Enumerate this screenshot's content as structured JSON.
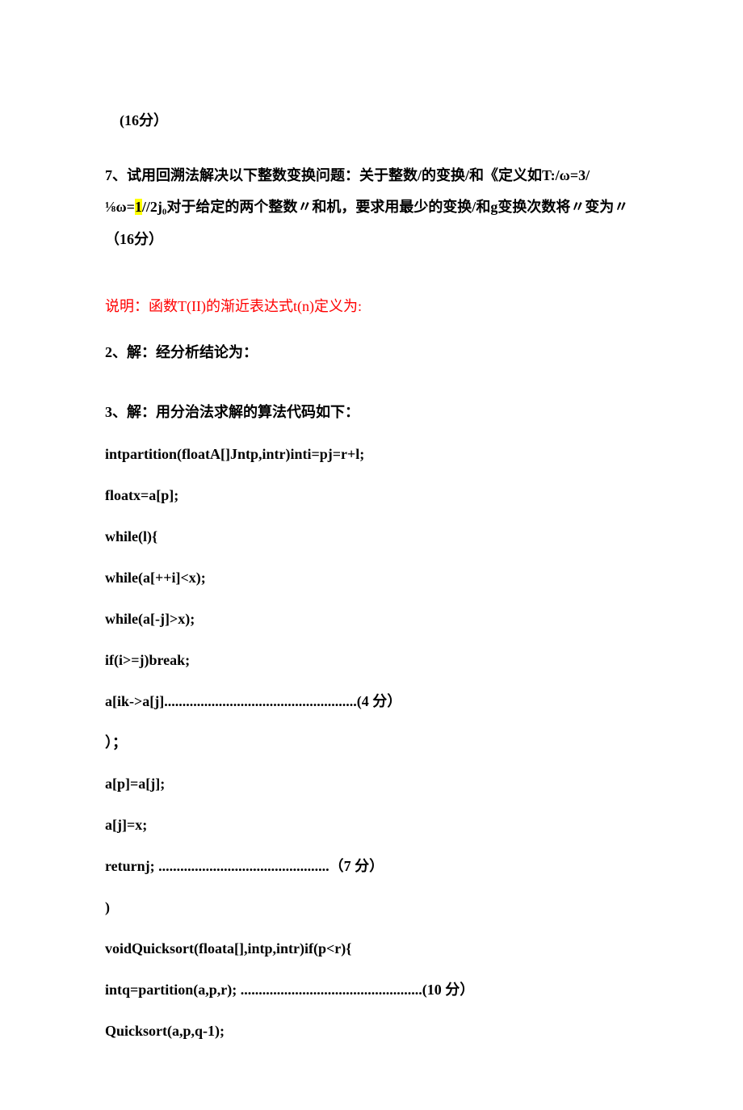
{
  "top": {
    "score16": "(16分）",
    "q7": "7、试用回溯法解决以下整数变换问题：关于整数/的变换/和《定义如T:/ω=3/⅛ω=",
    "q7_hl": "1",
    "q7_tail": "//2j₀对于给定的两个整数〃和机，要求用最少的变换/和g变换次数将〃变为〃（16分）"
  },
  "note": "说明：函数T(II)的渐近表达式t(n)定义为:",
  "a2": "2、解：经分析结论为：",
  "a3": "3、解：用分治法求解的算法代码如下：",
  "code": {
    "l1": "intpartition(floatA[]Jntp,intr)inti=pj=r+l;",
    "l2": "floatx=a[p];",
    "l3": "while(l){",
    "l4": "while(a[++i]<x);",
    "l5": "while(a[-j]>x);",
    "l6": "if(i>=j)break;",
    "l7": "a[ik->a[j].....................................................(4   分）",
    "l8": "）；",
    "l9": "a[p]=a[j];",
    "l10": "a[j]=x;",
    "l11": "returnj; ...............................................（7   分）",
    "l12": ")",
    "l13": "voidQuicksort(floata[],intp,intr)if(p<r){",
    "l14": "intq=partition(a,p,r); ..................................................(10   分）",
    "l15": "Quicksort(a,p,q-1);"
  }
}
